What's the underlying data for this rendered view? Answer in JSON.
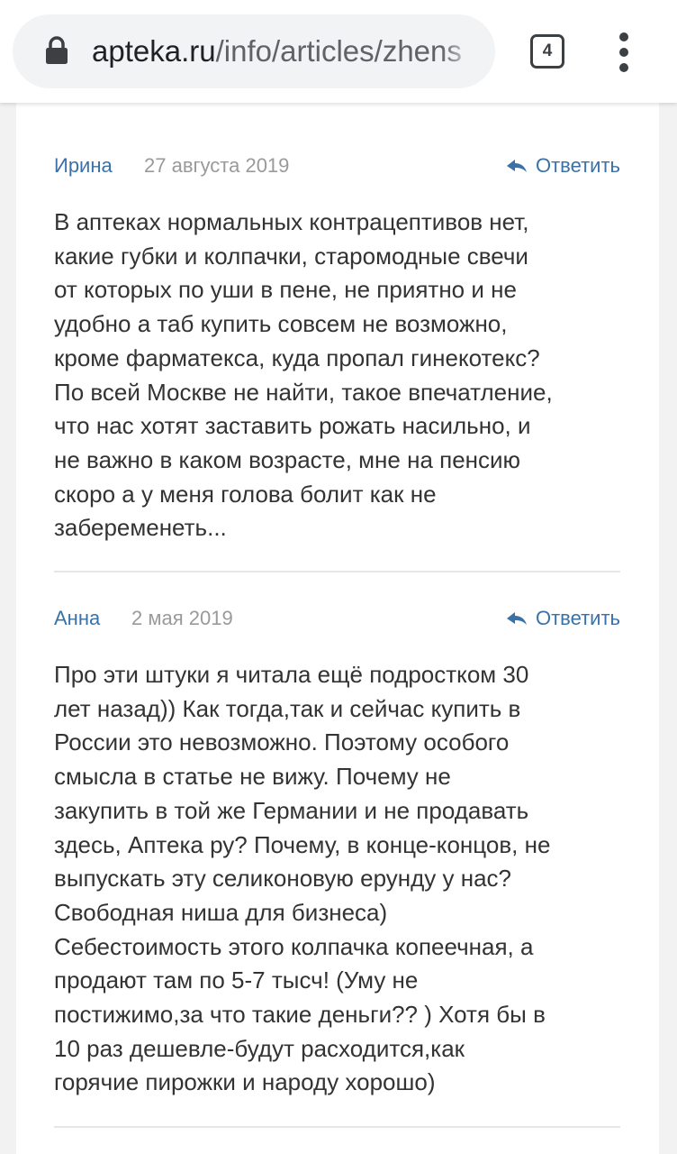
{
  "browser": {
    "url_domain": "apteka.ru",
    "url_path": "/info/articles/zhens",
    "tab_count": "4"
  },
  "comments": [
    {
      "author": "Ирина",
      "date": "27 августа 2019",
      "reply_label": "Ответить",
      "lines": [
        "В аптеках нормальных контрацептивов нет,",
        "какие губки и колпачки, старомодные свечи",
        "от которых по уши в пене, не приятно и не",
        "удобно а таб купить совсем не возможно,",
        "кроме фарматекса, куда пропал гинекотекс?",
        "По всей Москве не найти, такое впечатление,",
        "что нас хотят заставить рожать насильно, и",
        "не важно в каком возрасте, мне на пенсию",
        "скоро а у меня голова болит как не",
        "забеременеть..."
      ]
    },
    {
      "author": "Анна",
      "date": "2 мая 2019",
      "reply_label": "Ответить",
      "lines": [
        "Про эти штуки я читала ещё подростком 30",
        "лет назад)) Как тогда,так и сейчас купить в",
        "России это невозможно. Поэтому особого",
        "смысла в статье не вижу. Почему не",
        "закупить в той же Германии и не продавать",
        "здесь, Аптека ру? Почему, в конце-концов, не",
        "выпускать эту селиконовую ерунду у нас?",
        "Свободная ниша для бизнеса)",
        "Себестоимость этого колпачка копеечная, а",
        "продают там по 5-7 тысч! (Уму не",
        "постижимо,за что такие деньги?? ) Хотя бы в",
        "10 раз дешевле-будут расходится,как",
        "горячие пирожки и народу хорошо)"
      ]
    }
  ]
}
